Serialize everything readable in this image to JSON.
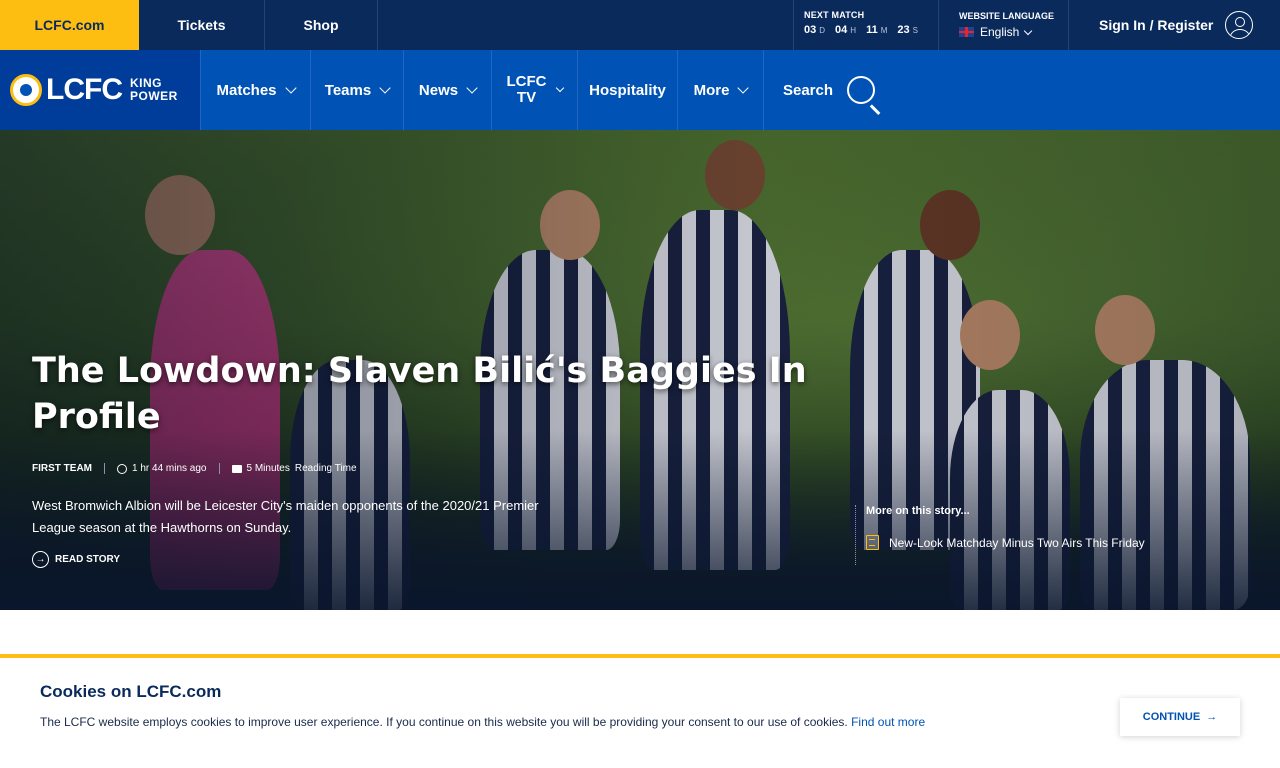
{
  "topbar": {
    "lcfc_link": "LCFC.com",
    "tickets": "Tickets",
    "shop": "Shop",
    "next_match": {
      "label": "NEXT MATCH",
      "days": "03",
      "days_unit": "D",
      "hours": "04",
      "hours_unit": "H",
      "minutes": "11",
      "minutes_unit": "M",
      "seconds": "23",
      "seconds_unit": "S"
    },
    "language": {
      "label": "WEBSITE LANGUAGE",
      "value": "English",
      "flag_icon": "uk-flag-icon"
    },
    "sign_in": "Sign In",
    "separator": "/",
    "register": "Register"
  },
  "nav": {
    "logo_wordmark": "LCFC",
    "logo_sponsor_line1": "KING",
    "logo_sponsor_line2": "POWER",
    "items": [
      {
        "label": "Matches"
      },
      {
        "label": "Teams"
      },
      {
        "label": "News"
      },
      {
        "label_line1": "LCFC",
        "label_line2": "TV"
      },
      {
        "label": "Hospitality"
      },
      {
        "label": "More"
      }
    ],
    "search": "Search"
  },
  "hero": {
    "headline": "The Lowdown: Slaven Bilić's Baggies In Profile",
    "category": "FIRST TEAM",
    "time_ago": "1 hr 44 mins ago",
    "read_time": "5 Minutes",
    "read_time_label": "Reading Time",
    "summary": "West Bromwich Albion will be Leicester City's maiden opponents of the 2020/21 Premier League season at the Hawthorns on Sunday.",
    "read_story": "READ STORY",
    "more_label": "More on this story...",
    "more_item": "New-Look Matchday Minus Two Airs This Friday"
  },
  "cookie": {
    "title": "Cookies on LCFC.com",
    "text": "The LCFC website employs cookies to improve user experience. If you continue on this website you will be providing your consent to our use of cookies.",
    "link": "Find out more",
    "continue": "CONTINUE"
  },
  "colors": {
    "navy": "#0a2a5c",
    "blue": "#0052b4",
    "gold": "#fdbe11"
  }
}
